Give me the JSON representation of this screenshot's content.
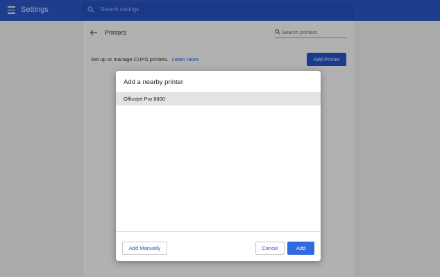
{
  "app": {
    "title": "Settings",
    "search_placeholder": "Search settings"
  },
  "page": {
    "title": "Printers",
    "search_placeholder": "Search printers",
    "setup_text": "Set up or manage CUPS printers.",
    "learn_more": "Learn more",
    "add_printer_label": "Add Printer"
  },
  "dialog": {
    "title": "Add a nearby printer",
    "printers": [
      "Officejet Pro 8600"
    ],
    "add_manually_label": "Add Manually",
    "cancel_label": "Cancel",
    "add_label": "Add"
  },
  "colors": {
    "app_bar": "#2a56c4",
    "primary_button": "#2f6ae0",
    "link": "#1a57c9"
  }
}
